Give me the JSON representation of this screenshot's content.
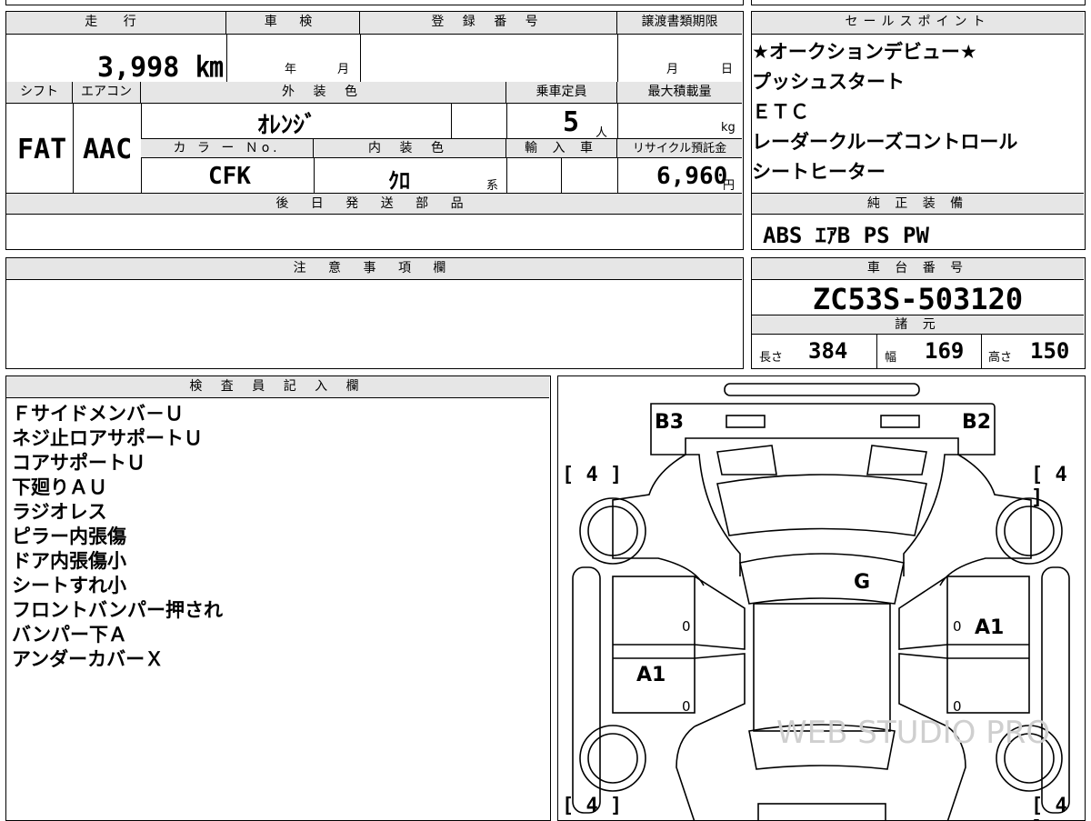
{
  "vehicle": {
    "mileage": {
      "label": "走 行",
      "value": "3,998 ㎞"
    },
    "inspection": {
      "label": "車 検",
      "year": "年",
      "month": "月"
    },
    "registration": {
      "label": "登 録 番 号"
    },
    "transfer_deadline": {
      "label": "譲渡書類期限",
      "month": "月",
      "day": "日"
    },
    "shift": {
      "label": "シフト",
      "value": "FAT"
    },
    "aircon": {
      "label": "エアコン",
      "value": "AAC"
    },
    "exterior_color": {
      "label": "外 装 色",
      "value": "ｵﾚﾝｼﾞ"
    },
    "capacity": {
      "label": "乗車定員",
      "value": "5",
      "unit": "人"
    },
    "max_load": {
      "label": "最大積載量",
      "unit": "kg"
    },
    "color_no": {
      "label": "カ ラ ー Ｎo.",
      "value": "CFK"
    },
    "interior_color": {
      "label": "内 装 色",
      "value": "ｸﾛ",
      "suffix": "系"
    },
    "import": {
      "label": "輸 入 車"
    },
    "recycle_fee": {
      "label": "リサイクル預託金",
      "value": "6,960",
      "unit": "円"
    },
    "later_parts": {
      "label": "後 日 発 送 部 品"
    }
  },
  "sales_points": {
    "title": "セールスポイント",
    "items": [
      "★オークションデビュー★",
      "プッシュスタート",
      "ＥＴＣ",
      "レーダークルーズコントロール",
      "シートヒーター"
    ]
  },
  "standard_equipment": {
    "title": "純 正 装 備",
    "value": "ABS ｴｱB PS PW"
  },
  "notes": {
    "title": "注 意 事 項 欄"
  },
  "chassis": {
    "title": "車 台 番 号",
    "value": "ZC53S-503120"
  },
  "specs": {
    "title": "諸 元",
    "length": {
      "label": "長さ",
      "value": "384"
    },
    "width": {
      "label": "幅",
      "value": "169"
    },
    "height": {
      "label": "高さ",
      "value": "150"
    }
  },
  "inspector": {
    "title": "検 査 員 記 入 欄",
    "items": [
      "Ｆサイドメンバ－Ｕ",
      "ネジ止ロアサポートＵ",
      "コアサポートＵ",
      "下廻りＡＵ",
      "ラジオレス",
      "ピラー内張傷",
      "ドア内張傷小",
      "シートすれ小",
      "フロントバンパー押され",
      "バンパー下Ａ",
      "アンダーカバーＸ"
    ]
  },
  "diagram": {
    "marks": {
      "b3": "B3",
      "b2": "B2",
      "g": "G",
      "a1_right": "A1",
      "a1_left": "A1"
    },
    "tire_labels": {
      "tl": "[ 4 ]",
      "tr": "[ 4 ]",
      "bl": "[ 4 ]",
      "br": "[ 4 ]"
    },
    "zeros": {
      "z1": "0",
      "z2": "0",
      "z3": "0",
      "z4": "0"
    },
    "watermark": "WEB STUDIO PRO"
  }
}
